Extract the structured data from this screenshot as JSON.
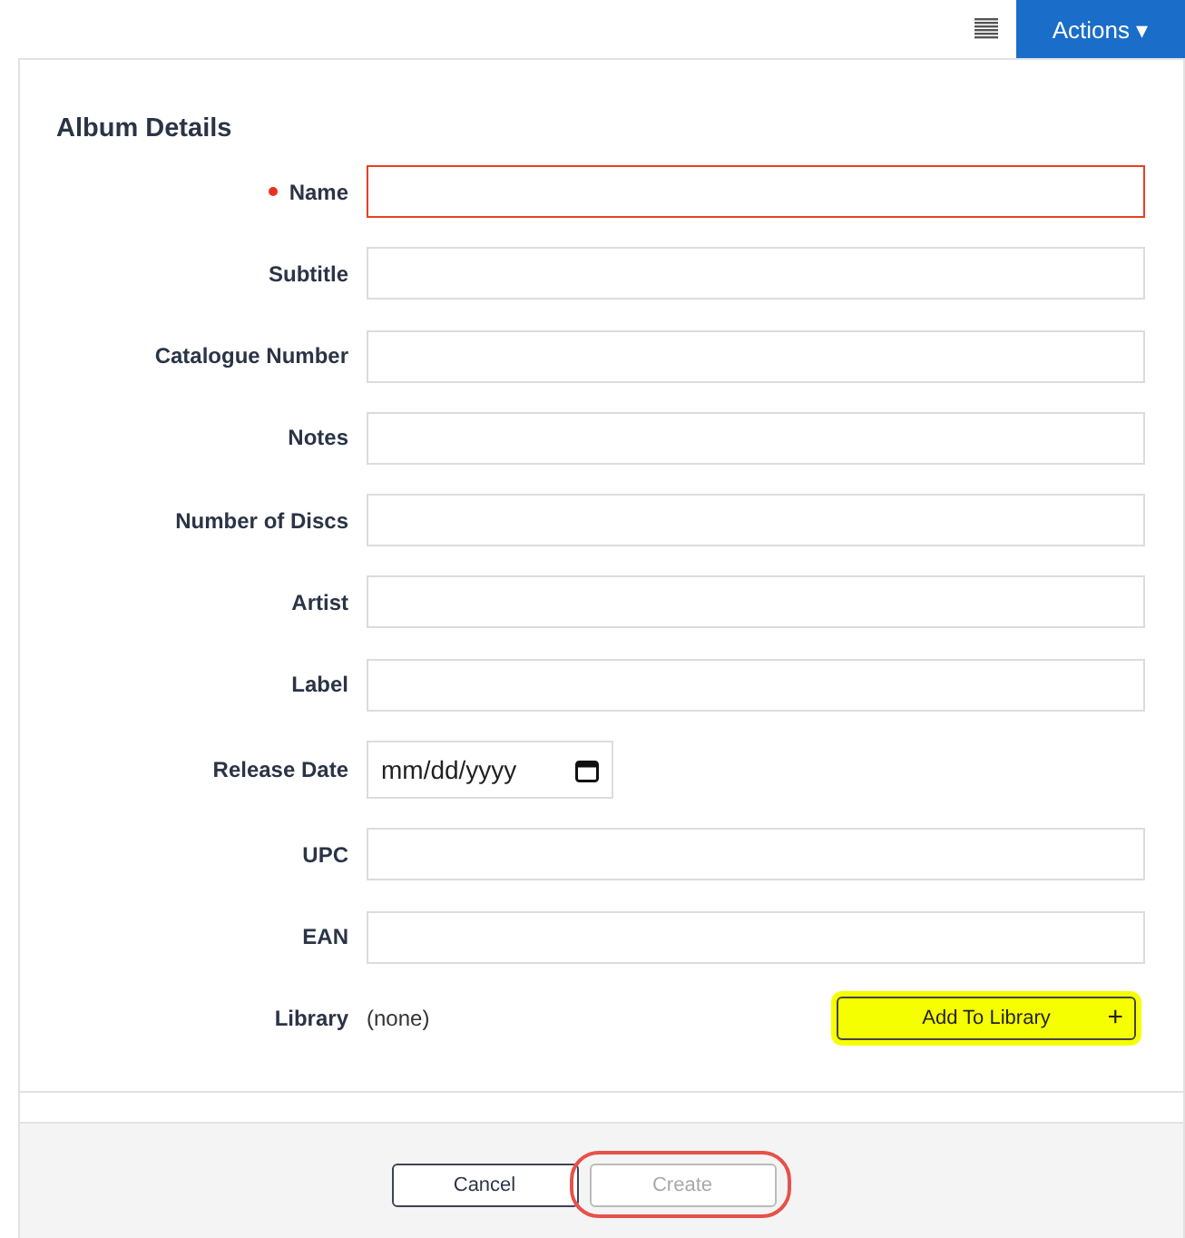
{
  "toolbar": {
    "actions_button": "Actions ▾"
  },
  "section": {
    "title": "Album Details"
  },
  "fields": [
    {
      "kind": "text",
      "label": "Name",
      "required": true
    },
    {
      "kind": "text",
      "label": "Subtitle",
      "required": false
    },
    {
      "kind": "text",
      "label": "Catalogue Number",
      "required": false
    },
    {
      "kind": "text",
      "label": "Notes",
      "required": false
    },
    {
      "kind": "text",
      "label": "Number of Discs",
      "required": false
    },
    {
      "kind": "text",
      "label": "Artist",
      "required": false
    },
    {
      "kind": "text",
      "label": "Label",
      "required": false
    },
    {
      "kind": "date",
      "label": "Release Date",
      "placeholder": "mm/dd/yyyy",
      "required": false
    },
    {
      "kind": "text",
      "label": "UPC",
      "required": false
    },
    {
      "kind": "text",
      "label": "EAN",
      "required": false
    },
    {
      "kind": "static",
      "label": "Library",
      "value": "(none)",
      "button": "Add To Library",
      "button_icon": "+",
      "required": false
    }
  ],
  "footer": {
    "buttons": [
      {
        "label": "Cancel",
        "disabled": false,
        "annotated": false
      },
      {
        "label": "Create",
        "disabled": true,
        "annotated": true
      }
    ]
  }
}
